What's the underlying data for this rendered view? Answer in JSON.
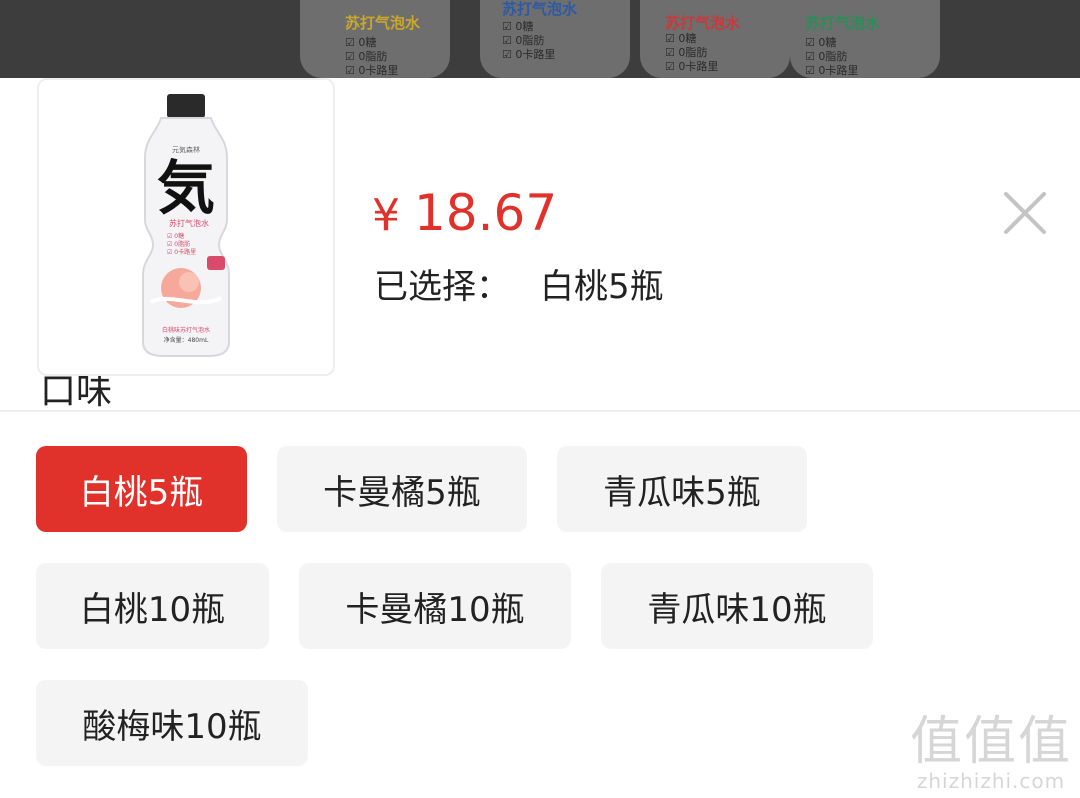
{
  "product": {
    "price_currency": "¥",
    "price_value": "18.67",
    "selected_label": "已选择：",
    "selected_value": "白桃5瓶",
    "thumbnail": {
      "brand_small": "元気森林",
      "logo_char": "気",
      "subtitle": "苏打气泡水",
      "checks": [
        "☑ 0糖",
        "☑ 0脂肪",
        "☑ 0卡路里"
      ],
      "flavor_name": "白桃味苏打气泡水",
      "volume": "净含量：480mL"
    }
  },
  "background_bottles": [
    {
      "label": "苏打气泡水",
      "color": "#c9a82a",
      "checks": [
        "☑ 0糖",
        "☑ 0脂肪",
        "☑ 0卡路里"
      ]
    },
    {
      "label": "苏打气泡水",
      "color": "#2c5aa8",
      "checks": [
        "☑ 0糖",
        "☑ 0脂肪",
        "☑ 0卡路里"
      ]
    },
    {
      "label": "苏打气泡水",
      "color": "#c83a3a",
      "checks": [
        "☑ 0糖",
        "☑ 0脂肪",
        "☑ 0卡路里"
      ]
    },
    {
      "label": "苏打气泡水",
      "color": "#2e8c5a",
      "checks": [
        "☑ 0糖",
        "☑ 0脂肪",
        "☑ 0卡路里"
      ]
    }
  ],
  "flavor_section": {
    "title": "口味",
    "options": [
      {
        "label": "白桃5瓶",
        "selected": true
      },
      {
        "label": "卡曼橘5瓶",
        "selected": false
      },
      {
        "label": "青瓜味5瓶",
        "selected": false
      },
      {
        "label": "白桃10瓶",
        "selected": false
      },
      {
        "label": "卡曼橘10瓶",
        "selected": false
      },
      {
        "label": "青瓜味10瓶",
        "selected": false
      },
      {
        "label": "酸梅味10瓶",
        "selected": false
      }
    ]
  },
  "watermark": {
    "main": "值值值",
    "sub": "zhizhizhi.com"
  },
  "colors": {
    "accent": "#e0312a",
    "chip_bg": "#f4f4f4",
    "text": "#222222"
  },
  "icons": {
    "close": "close-icon"
  }
}
